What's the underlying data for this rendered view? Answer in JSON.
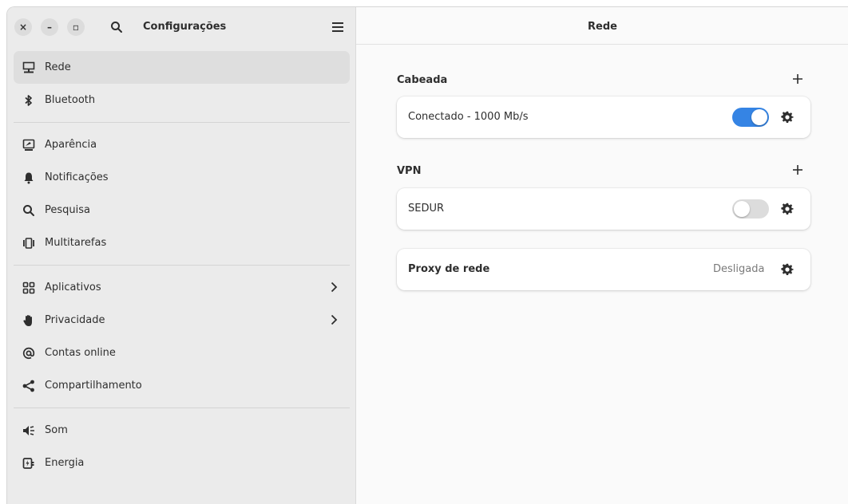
{
  "sidebar": {
    "title": "Configurações",
    "window_buttons": {
      "close": "×",
      "minimize": "–",
      "maximize": "▫"
    },
    "items": [
      {
        "label": "Rede",
        "icon": "network-wired-icon",
        "active": true
      },
      {
        "label": "Bluetooth",
        "icon": "bluetooth-icon"
      },
      {
        "label": "Aparência",
        "icon": "appearance-icon"
      },
      {
        "label": "Notificações",
        "icon": "bell-icon"
      },
      {
        "label": "Pesquisa",
        "icon": "search-icon"
      },
      {
        "label": "Multitarefas",
        "icon": "multitasking-icon"
      },
      {
        "label": "Aplicativos",
        "icon": "apps-grid-icon",
        "has_arrow": true
      },
      {
        "label": "Privacidade",
        "icon": "hand-icon",
        "has_arrow": true
      },
      {
        "label": "Contas online",
        "icon": "at-sign-icon"
      },
      {
        "label": "Compartilhamento",
        "icon": "share-icon"
      },
      {
        "label": "Som",
        "icon": "speaker-icon"
      },
      {
        "label": "Energia",
        "icon": "power-icon"
      }
    ]
  },
  "content": {
    "title": "Rede",
    "wired": {
      "heading": "Cabeada",
      "connection_label": "Conectado - 1000 Mb/s",
      "enabled": true
    },
    "vpn": {
      "heading": "VPN",
      "connection_label": "SEDUR",
      "enabled": false
    },
    "proxy": {
      "label": "Proxy de rede",
      "state": "Desligada"
    }
  },
  "colors": {
    "accent": "#3584e4",
    "sidebar_bg": "#ebebeb",
    "content_bg": "#fafafa"
  }
}
